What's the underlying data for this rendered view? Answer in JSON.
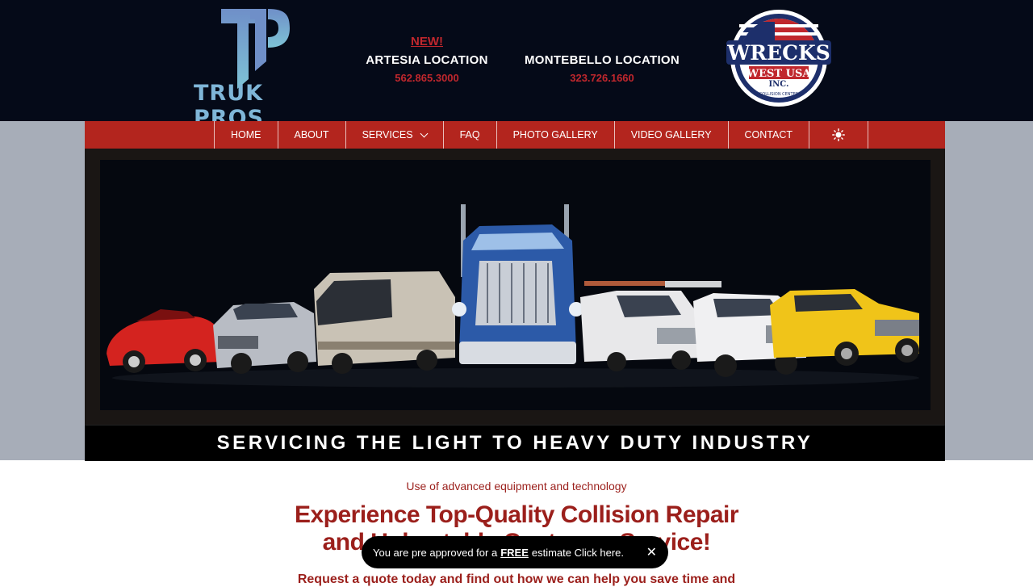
{
  "brand": {
    "logo_initials": "TP",
    "logo_name": "TRUK PROS"
  },
  "locations": [
    {
      "badge": "NEW!",
      "name": "ARTESIA LOCATION",
      "phone": "562.865.3000"
    },
    {
      "badge": "",
      "name": "MONTEBELLO LOCATION",
      "phone": "323.726.1660"
    }
  ],
  "partner_badge": {
    "line1": "WRECKS",
    "line2": "WEST USA",
    "line3": "INC.",
    "ring_text": "COLLISION CENTER"
  },
  "nav": {
    "items": [
      "HOME",
      "ABOUT",
      "SERVICES",
      "FAQ",
      "PHOTO GALLERY",
      "VIDEO GALLERY",
      "CONTACT"
    ],
    "theme_icon": "sun-icon"
  },
  "hero": {
    "tagline": "SERVICING THE LIGHT TO HEAVY DUTY INDUSTRY"
  },
  "content": {
    "subheading": "Use of advanced equipment and technology",
    "headline_line1": "Experience Top-Quality Collision Repair",
    "headline_line2": "and Unbeatable Customer Service!",
    "request_text": "Request a quote today and find out how we can help you save time and"
  },
  "toast": {
    "text_before": "You are pre approved for a",
    "free": "FREE",
    "text_after": "estimate Click here.",
    "close": "✕"
  },
  "colors": {
    "brand_red": "#b3251e",
    "header_bg": "#050a18",
    "heading_red": "#9b1f1b",
    "side_band": "#a7adb8"
  }
}
